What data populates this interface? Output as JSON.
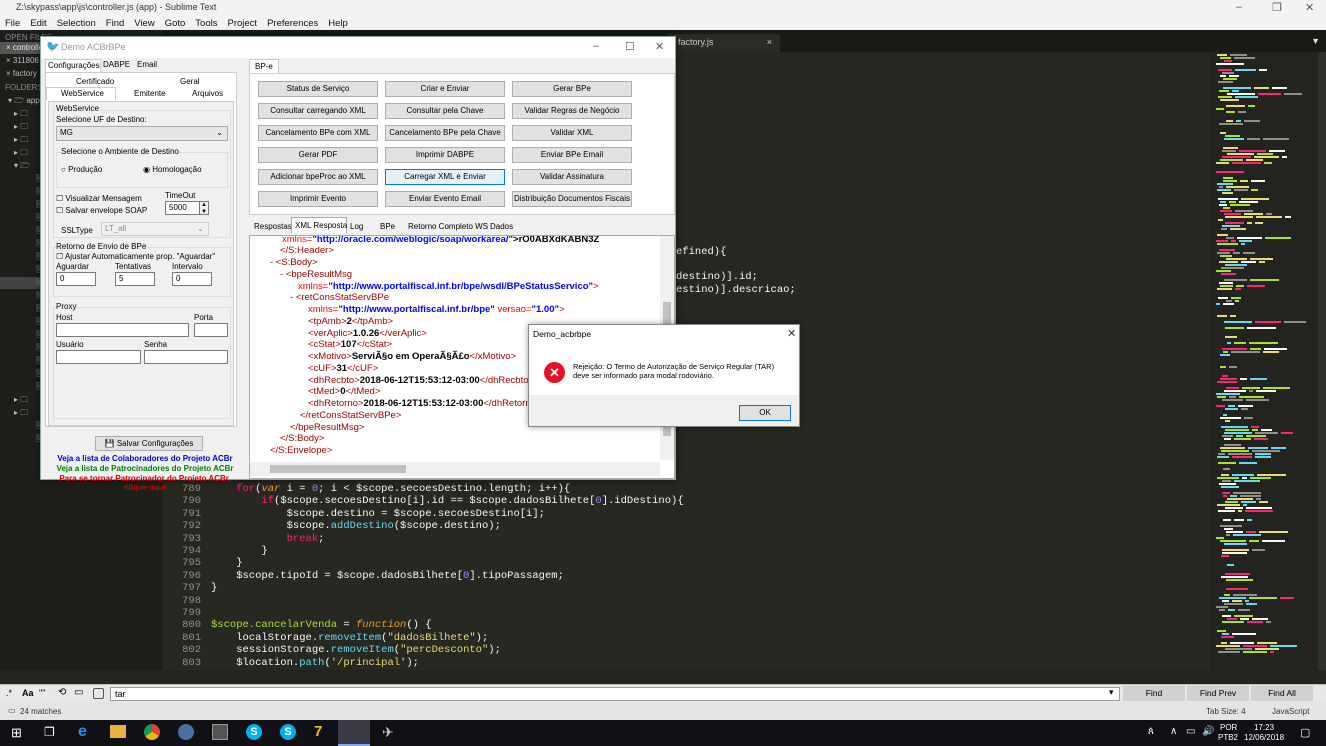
{
  "sublime": {
    "title": "Z:\\skypass\\app\\js\\controller.js (app) - Sublime Text",
    "menu": [
      "File",
      "Edit",
      "Selection",
      "Find",
      "View",
      "Goto",
      "Tools",
      "Project",
      "Preferences",
      "Help"
    ],
    "sidebar": {
      "open_files_label": "OPEN FILES",
      "open_files": [
        "controller.js",
        "311806",
        "factory"
      ],
      "folders_label": "FOLDERS",
      "folder_root": "app"
    },
    "tabs": [
      "factory.js"
    ],
    "code_fragments": [
      "efined){",
      "destino)].id;",
      "estino)].descricao;"
    ],
    "code_lines": [
      {
        "n": "789",
        "t": "    for(var i = 0; i < $scope.secoesDestino.length; i++){"
      },
      {
        "n": "790",
        "t": "        if($scope.secoesDestino[i].id == $scope.dadosBilhete[0].idDestino){"
      },
      {
        "n": "791",
        "t": "            $scope.destino = $scope.secoesDestino[i];"
      },
      {
        "n": "792",
        "t": "            $scope.addDestino($scope.destino);"
      },
      {
        "n": "793",
        "t": "            break;"
      },
      {
        "n": "794",
        "t": "        }"
      },
      {
        "n": "795",
        "t": "    }"
      },
      {
        "n": "796",
        "t": "    $scope.tipoId = $scope.dadosBilhete[0].tipoPassagem;"
      },
      {
        "n": "797",
        "t": "}"
      },
      {
        "n": "798",
        "t": ""
      },
      {
        "n": "799",
        "t": ""
      },
      {
        "n": "800",
        "t": "$scope.cancelarVenda = function() {"
      },
      {
        "n": "801",
        "t": "    localStorage.removeItem(\"dadosBilhete\");"
      },
      {
        "n": "802",
        "t": "    sessionStorage.removeItem(\"percDesconto\");"
      },
      {
        "n": "803",
        "t": "    $location.path('/principal');"
      }
    ],
    "find": {
      "value": "tar",
      "find": "Find",
      "find_prev": "Find Prev",
      "find_all": "Find All",
      "case_label": "Aa",
      "word_label": "\"\""
    },
    "status": {
      "matches": "24 matches",
      "tab_size": "Tab Size: 4",
      "syntax": "JavaScript"
    }
  },
  "acbr": {
    "title": "Demo ACBrBPe",
    "left_tabs": [
      "Configurações",
      "DABPE",
      "Email"
    ],
    "sub_tabs_row1": [
      "Certificado",
      "Geral"
    ],
    "sub_tabs_row2": [
      "WebService",
      "Emitente",
      "Arquivos"
    ],
    "webservice": {
      "group": "WebService",
      "uf_label": "Selecione UF de Destino:",
      "uf_value": "MG",
      "ambiente_label": "Selecione o Ambiente de Destino",
      "producao": "Produção",
      "homologacao": "Homologação",
      "visualizar": "Visualizar Mensagem",
      "salvar_soap": "Salvar envelope SOAP",
      "timeout_label": "TimeOut",
      "timeout_value": "5000",
      "ssltype_label": "SSLType",
      "ssltype_value": "LT_all"
    },
    "retorno": {
      "group": "Retorno de Envio de BPe",
      "ajustar": "Ajustar Automaticamente prop. \"Aguardar\"",
      "aguardar_label": "Aguardar",
      "aguardar_value": "0",
      "tentativas_label": "Tentativas",
      "tentativas_value": "5",
      "intervalo_label": "Intervalo",
      "intervalo_value": "0"
    },
    "proxy": {
      "group": "Proxy",
      "host": "Host",
      "porta": "Porta",
      "usuario": "Usuário",
      "senha": "Senha"
    },
    "salvar_btn": "Salvar Configurações",
    "links": [
      "Veja a lista de Colaboradores do Projeto ACBr",
      "Veja a lista de Patrocinadores do Projeto ACBr",
      "Para se tornar Patrocinador do Projeto ACBr,",
      "clique aqui"
    ],
    "right_tab": "BP-e",
    "buttons": [
      [
        "Status de Serviço",
        "Criar e Enviar",
        "Gerar BPe"
      ],
      [
        "Consultar carregando XML",
        "Consultar pela Chave",
        "Validar Regras de Negócio"
      ],
      [
        "Cancelamento BPe com XML",
        "Cancelamento BPe pela Chave",
        "Validar XML"
      ],
      [
        "Gerar PDF",
        "Imprimir DABPE",
        "Enviar BPe Email"
      ],
      [
        "Adicionar bpeProc ao XML",
        "Carregar XML e Enviar",
        "Validar Assinatura"
      ],
      [
        "Imprimir Evento",
        "Enviar Evento Email",
        "Distribuição Documentos Fiscais"
      ]
    ],
    "resp_tabs": [
      "Respostas",
      "XML Resposta",
      "Log",
      "BPe",
      "Retorno Completo WS",
      "Dados"
    ],
    "xml": {
      "l0_attr": "xmlns=",
      "l0_val": "\"http://oracle.com/weblogic/soap/workarea/\"",
      "l0_rest": ">rO0ABXdKABN3Z",
      "header_close": "</S:Header>",
      "body_open": "<S:Body>",
      "bpe_result": "<bpeResultMsg",
      "bpe_ns_attr": "xmlns=",
      "bpe_ns_val": "\"http://www.portalfiscal.inf.br/bpe/wsdl/BPeStatusServico\"",
      "ret_open": "<retConsStatServBPe",
      "ret_ns_attr": "xmlns=",
      "ret_ns_val": "\"http://www.portalfiscal.inf.br/bpe\"",
      "versao_attr": "versao=",
      "versao_val": "\"1.00\"",
      "tpAmb": "2",
      "verAplic": "1.0.26",
      "cStat": "107",
      "xMotivo": "ServiÃ§o em OperaÃ§Ã£o",
      "cUF": "31",
      "dhRecbto": "2018-06-12T15:53:12-03:00",
      "tMed": "0",
      "dhRetorno": "2018-06-12T15:53:12-03:00",
      "ret_close": "</retConsStatServBPe>",
      "bpe_close": "</bpeResultMsg>",
      "body_close": "</S:Body>",
      "env_close": "</S:Envelope>"
    }
  },
  "dialog": {
    "title": "Demo_acbrbpe",
    "message": "Rejeição: O Termo de Autorização de Serviço Regular (TAR) deve ser informado para modal rodoviário.",
    "ok": "OK"
  },
  "taskbar": {
    "time": "17:23",
    "date": "12/06/2018",
    "lang1": "POR",
    "lang2": "PTB2"
  }
}
